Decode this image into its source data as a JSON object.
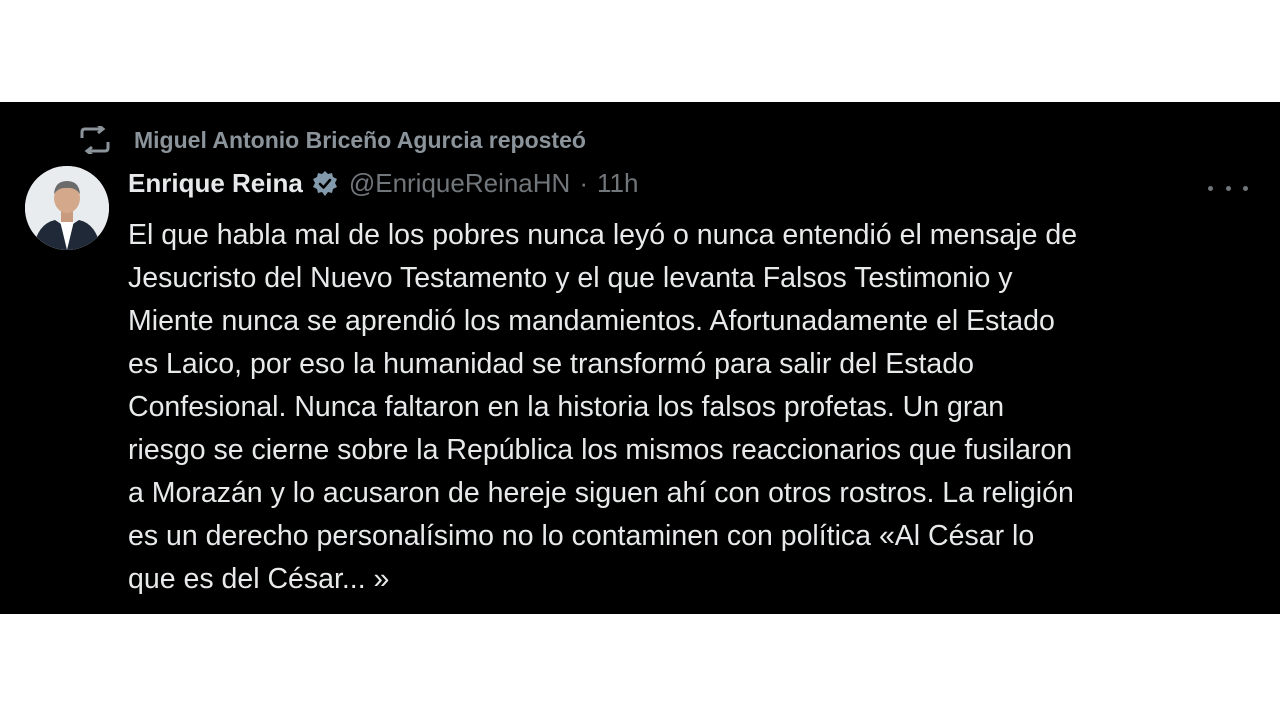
{
  "repost": {
    "icon": "repost-icon",
    "text": "Miguel Antonio Briceño Agurcia reposteó"
  },
  "author": {
    "display_name": "Enrique Reina",
    "verified_icon": "verified-badge-icon",
    "handle": "@EnriqueReinaHN",
    "separator": "·",
    "time": "11h"
  },
  "more_icon": "more-options-icon",
  "tweet": {
    "text": "El que habla mal de los pobres nunca leyó o nunca entendió el mensaje de\nJesucristo del Nuevo Testamento y el que levanta Falsos Testimonio y\nMiente nunca se aprendió los mandamientos. Afortunadamente el Estado\nes Laico, por eso la humanidad se transformó para salir del Estado\nConfesional. Nunca faltaron en la historia los falsos profetas. Un gran\nriesgo se cierne sobre la República los mismos reaccionarios que fusilaron\na Morazán y lo acusaron de hereje siguen ahí con otros rostros. La religión\nes un derecho personalísimo no lo contaminen con política «Al César lo\nque es del César... »"
  },
  "colors": {
    "background": "#000000",
    "primary_text": "#e7e9ea",
    "secondary_text": "#71767b",
    "verified": "#829aab"
  }
}
